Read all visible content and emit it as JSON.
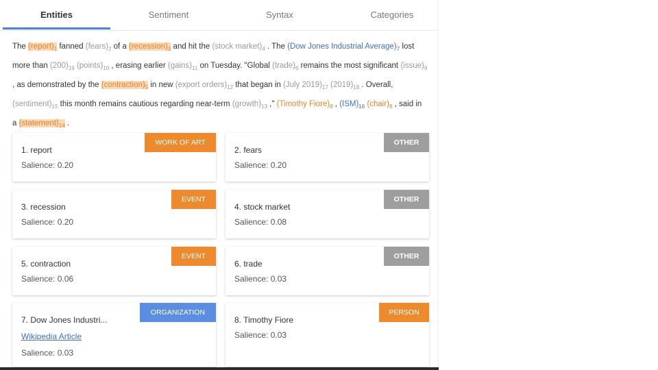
{
  "tabs": {
    "entities": "Entities",
    "sentiment": "Sentiment",
    "syntax": "Syntax",
    "categories": "Categories"
  },
  "analyzed_text": {
    "s01": "The ",
    "e01": "(report)",
    "n01": "1",
    "s02": " fanned ",
    "e02": "(fears)",
    "n02": "2",
    "s03": " of a ",
    "e03": "(recession)",
    "n03": "3",
    "s04": " and hit the ",
    "e04": "(stock market)",
    "n04": "4",
    "s05": " . The ",
    "e05": "(Dow Jones Industrial Average)",
    "n05": "7",
    "s06": " lost more than ",
    "e06": "(200)",
    "n06": "19",
    "s07": " ",
    "e07": "(points)",
    "n07": "10",
    "s08": " , erasing earlier ",
    "e08": "(gains)",
    "n08": "11",
    "s09": " on Tuesday. \"Global ",
    "e09": "(trade)",
    "n09": "6",
    "s10": " remains the most significant ",
    "e10": "(issue)",
    "n10": "9",
    "s11": " , as demonstrated by the ",
    "e11": "(contraction)",
    "n11": "5",
    "s12": " in new ",
    "e12": "(export orders)",
    "n12": "12",
    "s13": " that began in ",
    "e13": "(July 2019)",
    "n13": "17",
    "s14": " ",
    "e14": "(2019)",
    "n14": "18",
    "s15": " . Overall, ",
    "e15": "(sentiment)",
    "n15": "15",
    "s16": " this month remains cautious regarding near-term ",
    "e16": "(growth)",
    "n16": "13",
    "s17": " ,\" ",
    "e17": "(Timothy Fiore)",
    "n17": "8",
    "s18": " , ",
    "e18": "(ISM)",
    "n18": "16",
    "s19": " ",
    "e19": "(chair)",
    "n19": "8",
    "s20": " , said in a ",
    "e20": "(statement)",
    "n20": "14",
    "s21": " ."
  },
  "cards": [
    {
      "title": "1. report",
      "badge": "WORK OF ART",
      "salience": "Salience: 0.20"
    },
    {
      "title": "2. fears",
      "badge": "OTHER",
      "salience": "Salience: 0.20"
    },
    {
      "title": "3. recession",
      "badge": "EVENT",
      "salience": "Salience: 0.20"
    },
    {
      "title": "4. stock market",
      "badge": "OTHER",
      "salience": "Salience: 0.08"
    },
    {
      "title": "5. contraction",
      "badge": "EVENT",
      "salience": "Salience: 0.06"
    },
    {
      "title": "6. trade",
      "badge": "OTHER",
      "salience": "Salience: 0.03"
    },
    {
      "title": "7. Dow Jones Industri...",
      "badge": "ORGANIZATION",
      "link": "Wikipedia Article",
      "salience": "Salience: 0.03"
    },
    {
      "title": "8. Timothy Fiore",
      "badge": "PERSON",
      "salience": "Salience: 0.03"
    }
  ],
  "colors": {
    "accent_blue": "#4a7fd6",
    "badge_orange": "#ee8a2e",
    "badge_grey": "#9e9e9e",
    "badge_blue": "#5b8de0"
  }
}
